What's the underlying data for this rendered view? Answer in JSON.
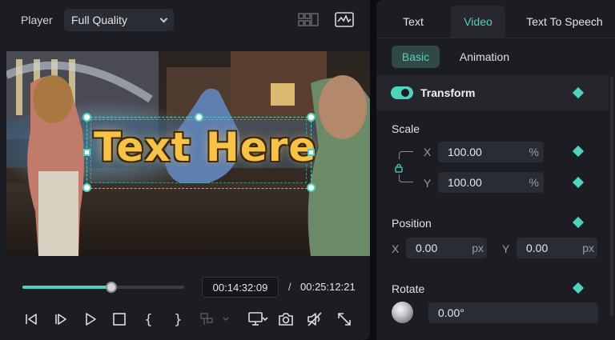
{
  "player": {
    "title": "Player",
    "quality": "Full Quality",
    "overlay_text": "Text Here",
    "time_current": "00:14:32:09",
    "time_separator": "/",
    "time_total": "00:25:12:21",
    "progress_fraction": 0.55
  },
  "icons": {
    "grid_view": "grid-view-icon",
    "waveform": "waveform-monitor-icon",
    "prev_frame": "previous-frame-icon",
    "next_frame": "next-frame-icon",
    "play": "play-icon",
    "stop": "stop-icon",
    "mark_in": "mark-in-icon",
    "mark_out": "mark-out-icon",
    "insert": "insert-clip-icon",
    "display": "display-settings-icon",
    "snapshot": "camera-icon",
    "audio": "speaker-mute-icon",
    "fullscreen": "fullscreen-icon"
  },
  "inspector": {
    "tabs": [
      {
        "label": "Text",
        "active": false
      },
      {
        "label": "Video",
        "active": true
      },
      {
        "label": "Text To Speech",
        "active": false
      }
    ],
    "subtabs": [
      {
        "label": "Basic",
        "active": true
      },
      {
        "label": "Animation",
        "active": false
      }
    ],
    "transform": {
      "label": "Transform",
      "enabled": true
    },
    "scale": {
      "label": "Scale",
      "x_axis": "X",
      "x_value": "100.00",
      "x_unit": "%",
      "y_axis": "Y",
      "y_value": "100.00",
      "y_unit": "%"
    },
    "position": {
      "label": "Position",
      "x_axis": "X",
      "x_value": "0.00",
      "x_unit": "px",
      "y_axis": "Y",
      "y_value": "0.00",
      "y_unit": "px"
    },
    "rotate": {
      "label": "Rotate",
      "value": "0.00°"
    }
  },
  "colors": {
    "accent": "#4fd3bf",
    "panel": "#1c1d22",
    "background": "#0c0d10",
    "overlay_text": "#f8c246"
  }
}
